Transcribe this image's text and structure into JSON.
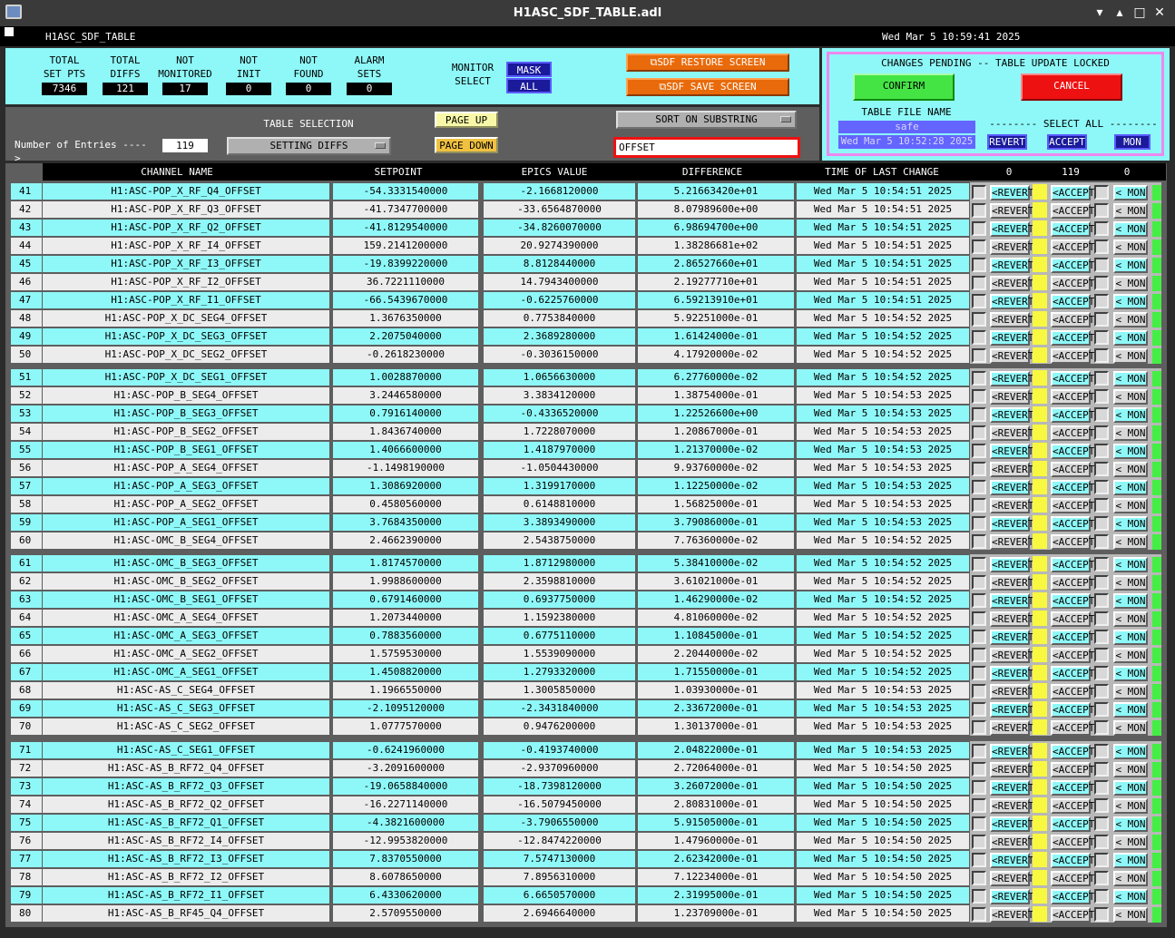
{
  "window": {
    "title": "H1ASC_SDF_TABLE.adl",
    "name": "H1ASC_SDF_TABLE",
    "datetime": "Wed Mar  5 10:59:41 2025",
    "min_glyph": "▾",
    "restore_glyph": "▴",
    "max_glyph": "□",
    "close_glyph": "✕"
  },
  "stats": [
    {
      "label": "TOTAL\nSET PTS",
      "value": "7346"
    },
    {
      "label": "TOTAL\nDIFFS",
      "value": "121"
    },
    {
      "label": "NOT\nMONITORED",
      "value": "17"
    },
    {
      "label": "NOT\nINIT",
      "value": "0"
    },
    {
      "label": "NOT\nFOUND",
      "value": "0"
    },
    {
      "label": "ALARM\nSETS",
      "value": "0"
    }
  ],
  "monitor": {
    "label": "MONITOR\nSELECT",
    "mask": "MASK",
    "all": "ALL"
  },
  "screens": {
    "restore": "SDF RESTORE SCREEN",
    "save": "SDF SAVE SCREEN"
  },
  "changes": {
    "title": "CHANGES PENDING -- TABLE UPDATE LOCKED",
    "confirm": "CONFIRM",
    "cancel": "CANCEL",
    "file_label": "TABLE FILE NAME",
    "file_value": "safe",
    "file_time": "Wed Mar  5 10:52:28 2025",
    "select_all": "-------- SELECT ALL --------",
    "revert": "REVERT",
    "accept": "ACCEPT",
    "mon": "MON"
  },
  "table_sel": {
    "label": "TABLE SELECTION",
    "value": "SETTING DIFFS",
    "entries_label": "Number of Entries ---->",
    "entries": "119",
    "page_up": "PAGE UP",
    "page_down": "PAGE DOWN",
    "sort_label": "SORT ON SUBSTRING",
    "substring": "OFFSET"
  },
  "colors": {
    "accent_cyan": "#8ef8f8",
    "confirm": "#44e444",
    "cancel": "#ee1111",
    "pink": "#ee88ee"
  },
  "headers": {
    "channel": "CHANNEL NAME",
    "setpoint": "SETPOINT",
    "epics": "EPICS VALUE",
    "difference": "DIFFERENCE",
    "time": "TIME OF LAST CHANGE",
    "count_revert": "0",
    "count_accept": "119",
    "count_mon": "0"
  },
  "row_labels": {
    "revert": "<REVERT",
    "accept": "<ACCEPT",
    "mon": "< MON"
  },
  "rows": [
    [
      "41",
      "H1:ASC-POP_X_RF_Q4_OFFSET",
      "-54.3331540000",
      "-2.1668120000",
      "5.21663420e+01",
      "Wed Mar  5 10:54:51 2025"
    ],
    [
      "42",
      "H1:ASC-POP_X_RF_Q3_OFFSET",
      "-41.7347700000",
      "-33.6564870000",
      "8.07989600e+00",
      "Wed Mar  5 10:54:51 2025"
    ],
    [
      "43",
      "H1:ASC-POP_X_RF_Q2_OFFSET",
      "-41.8129540000",
      "-34.8260070000",
      "6.98694700e+00",
      "Wed Mar  5 10:54:51 2025"
    ],
    [
      "44",
      "H1:ASC-POP_X_RF_I4_OFFSET",
      "159.2141200000",
      "20.9274390000",
      "1.38286681e+02",
      "Wed Mar  5 10:54:51 2025"
    ],
    [
      "45",
      "H1:ASC-POP_X_RF_I3_OFFSET",
      "-19.8399220000",
      "8.8128440000",
      "2.86527660e+01",
      "Wed Mar  5 10:54:51 2025"
    ],
    [
      "46",
      "H1:ASC-POP_X_RF_I2_OFFSET",
      "36.7221110000",
      "14.7943400000",
      "2.19277710e+01",
      "Wed Mar  5 10:54:51 2025"
    ],
    [
      "47",
      "H1:ASC-POP_X_RF_I1_OFFSET",
      "-66.5439670000",
      "-0.6225760000",
      "6.59213910e+01",
      "Wed Mar  5 10:54:51 2025"
    ],
    [
      "48",
      "H1:ASC-POP_X_DC_SEG4_OFFSET",
      "1.3676350000",
      "0.7753840000",
      "5.92251000e-01",
      "Wed Mar  5 10:54:52 2025"
    ],
    [
      "49",
      "H1:ASC-POP_X_DC_SEG3_OFFSET",
      "2.2075040000",
      "2.3689280000",
      "1.61424000e-01",
      "Wed Mar  5 10:54:52 2025"
    ],
    [
      "50",
      "H1:ASC-POP_X_DC_SEG2_OFFSET",
      "-0.2618230000",
      "-0.3036150000",
      "4.17920000e-02",
      "Wed Mar  5 10:54:52 2025"
    ],
    [
      "51",
      "H1:ASC-POP_X_DC_SEG1_OFFSET",
      "1.0028870000",
      "1.0656630000",
      "6.27760000e-02",
      "Wed Mar  5 10:54:52 2025"
    ],
    [
      "52",
      "H1:ASC-POP_B_SEG4_OFFSET",
      "3.2446580000",
      "3.3834120000",
      "1.38754000e-01",
      "Wed Mar  5 10:54:53 2025"
    ],
    [
      "53",
      "H1:ASC-POP_B_SEG3_OFFSET",
      "0.7916140000",
      "-0.4336520000",
      "1.22526600e+00",
      "Wed Mar  5 10:54:53 2025"
    ],
    [
      "54",
      "H1:ASC-POP_B_SEG2_OFFSET",
      "1.8436740000",
      "1.7228070000",
      "1.20867000e-01",
      "Wed Mar  5 10:54:53 2025"
    ],
    [
      "55",
      "H1:ASC-POP_B_SEG1_OFFSET",
      "1.4066600000",
      "1.4187970000",
      "1.21370000e-02",
      "Wed Mar  5 10:54:53 2025"
    ],
    [
      "56",
      "H1:ASC-POP_A_SEG4_OFFSET",
      "-1.1498190000",
      "-1.0504430000",
      "9.93760000e-02",
      "Wed Mar  5 10:54:53 2025"
    ],
    [
      "57",
      "H1:ASC-POP_A_SEG3_OFFSET",
      "1.3086920000",
      "1.3199170000",
      "1.12250000e-02",
      "Wed Mar  5 10:54:53 2025"
    ],
    [
      "58",
      "H1:ASC-POP_A_SEG2_OFFSET",
      "0.4580560000",
      "0.6148810000",
      "1.56825000e-01",
      "Wed Mar  5 10:54:53 2025"
    ],
    [
      "59",
      "H1:ASC-POP_A_SEG1_OFFSET",
      "3.7684350000",
      "3.3893490000",
      "3.79086000e-01",
      "Wed Mar  5 10:54:53 2025"
    ],
    [
      "60",
      "H1:ASC-OMC_B_SEG4_OFFSET",
      "2.4662390000",
      "2.5438750000",
      "7.76360000e-02",
      "Wed Mar  5 10:54:52 2025"
    ],
    [
      "61",
      "H1:ASC-OMC_B_SEG3_OFFSET",
      "1.8174570000",
      "1.8712980000",
      "5.38410000e-02",
      "Wed Mar  5 10:54:52 2025"
    ],
    [
      "62",
      "H1:ASC-OMC_B_SEG2_OFFSET",
      "1.9988600000",
      "2.3598810000",
      "3.61021000e-01",
      "Wed Mar  5 10:54:52 2025"
    ],
    [
      "63",
      "H1:ASC-OMC_B_SEG1_OFFSET",
      "0.6791460000",
      "0.6937750000",
      "1.46290000e-02",
      "Wed Mar  5 10:54:52 2025"
    ],
    [
      "64",
      "H1:ASC-OMC_A_SEG4_OFFSET",
      "1.2073440000",
      "1.1592380000",
      "4.81060000e-02",
      "Wed Mar  5 10:54:52 2025"
    ],
    [
      "65",
      "H1:ASC-OMC_A_SEG3_OFFSET",
      "0.7883560000",
      "0.6775110000",
      "1.10845000e-01",
      "Wed Mar  5 10:54:52 2025"
    ],
    [
      "66",
      "H1:ASC-OMC_A_SEG2_OFFSET",
      "1.5759530000",
      "1.5539090000",
      "2.20440000e-02",
      "Wed Mar  5 10:54:52 2025"
    ],
    [
      "67",
      "H1:ASC-OMC_A_SEG1_OFFSET",
      "1.4508820000",
      "1.2793320000",
      "1.71550000e-01",
      "Wed Mar  5 10:54:52 2025"
    ],
    [
      "68",
      "H1:ASC-AS_C_SEG4_OFFSET",
      "1.1966550000",
      "1.3005850000",
      "1.03930000e-01",
      "Wed Mar  5 10:54:53 2025"
    ],
    [
      "69",
      "H1:ASC-AS_C_SEG3_OFFSET",
      "-2.1095120000",
      "-2.3431840000",
      "2.33672000e-01",
      "Wed Mar  5 10:54:53 2025"
    ],
    [
      "70",
      "H1:ASC-AS_C_SEG2_OFFSET",
      "1.0777570000",
      "0.9476200000",
      "1.30137000e-01",
      "Wed Mar  5 10:54:53 2025"
    ],
    [
      "71",
      "H1:ASC-AS_C_SEG1_OFFSET",
      "-0.6241960000",
      "-0.4193740000",
      "2.04822000e-01",
      "Wed Mar  5 10:54:53 2025"
    ],
    [
      "72",
      "H1:ASC-AS_B_RF72_Q4_OFFSET",
      "-3.2091600000",
      "-2.9370960000",
      "2.72064000e-01",
      "Wed Mar  5 10:54:50 2025"
    ],
    [
      "73",
      "H1:ASC-AS_B_RF72_Q3_OFFSET",
      "-19.0658840000",
      "-18.7398120000",
      "3.26072000e-01",
      "Wed Mar  5 10:54:50 2025"
    ],
    [
      "74",
      "H1:ASC-AS_B_RF72_Q2_OFFSET",
      "-16.2271140000",
      "-16.5079450000",
      "2.80831000e-01",
      "Wed Mar  5 10:54:50 2025"
    ],
    [
      "75",
      "H1:ASC-AS_B_RF72_Q1_OFFSET",
      "-4.3821600000",
      "-3.7906550000",
      "5.91505000e-01",
      "Wed Mar  5 10:54:50 2025"
    ],
    [
      "76",
      "H1:ASC-AS_B_RF72_I4_OFFSET",
      "-12.9953820000",
      "-12.8474220000",
      "1.47960000e-01",
      "Wed Mar  5 10:54:50 2025"
    ],
    [
      "77",
      "H1:ASC-AS_B_RF72_I3_OFFSET",
      "7.8370550000",
      "7.5747130000",
      "2.62342000e-01",
      "Wed Mar  5 10:54:50 2025"
    ],
    [
      "78",
      "H1:ASC-AS_B_RF72_I2_OFFSET",
      "8.6078650000",
      "7.8956310000",
      "7.12234000e-01",
      "Wed Mar  5 10:54:50 2025"
    ],
    [
      "79",
      "H1:ASC-AS_B_RF72_I1_OFFSET",
      "6.4330620000",
      "6.6650570000",
      "2.31995000e-01",
      "Wed Mar  5 10:54:50 2025"
    ],
    [
      "80",
      "H1:ASC-AS_B_RF45_Q4_OFFSET",
      "2.5709550000",
      "2.6946640000",
      "1.23709000e-01",
      "Wed Mar  5 10:54:50 2025"
    ]
  ]
}
